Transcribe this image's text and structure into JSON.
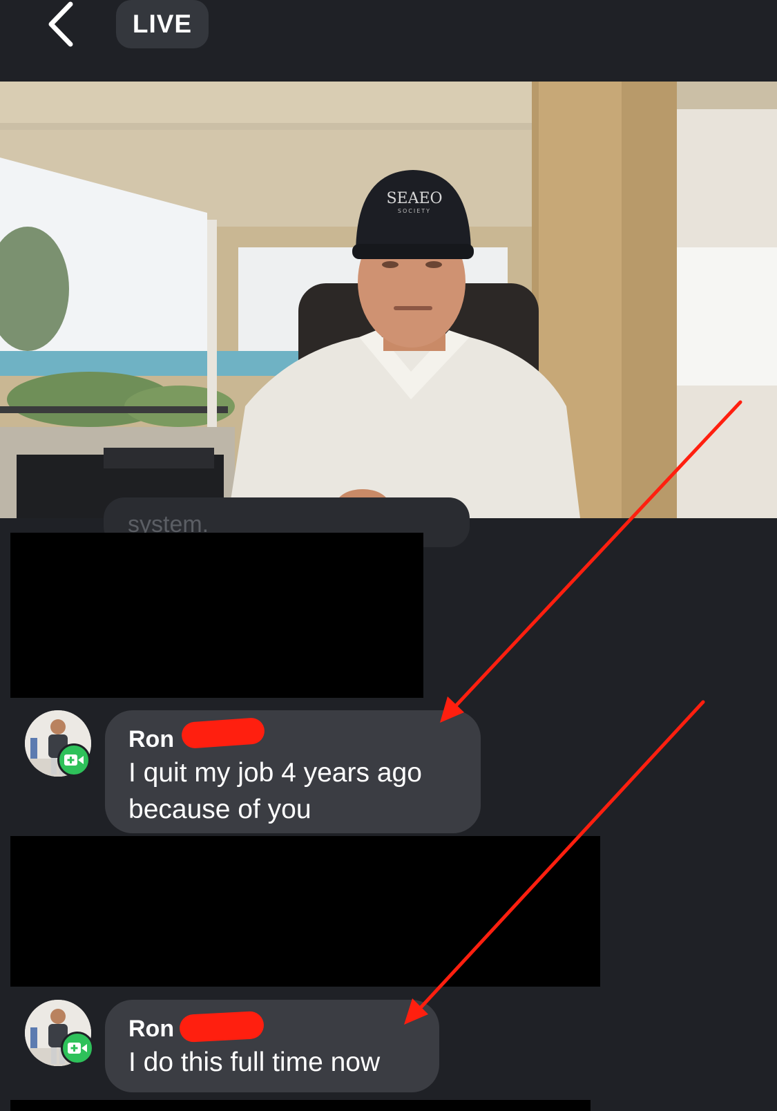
{
  "header": {
    "live_label": "LIVE"
  },
  "video": {
    "cap_text": "SEAEO",
    "cap_subtext": "SOCIETY"
  },
  "chat": {
    "faded_text": "system.",
    "comments": [
      {
        "author": "Ron",
        "message": "I quit my job 4 years ago because of you"
      },
      {
        "author": "Ron",
        "message": "I do this full time now"
      }
    ]
  },
  "colors": {
    "background": "#1f2126",
    "bubble": "#3b3d43",
    "annotation_red": "#ff1f0f",
    "camera_badge": "#2ec15a"
  },
  "icons": {
    "back": "chevron-left-icon",
    "badge": "video-camera-plus-icon"
  }
}
